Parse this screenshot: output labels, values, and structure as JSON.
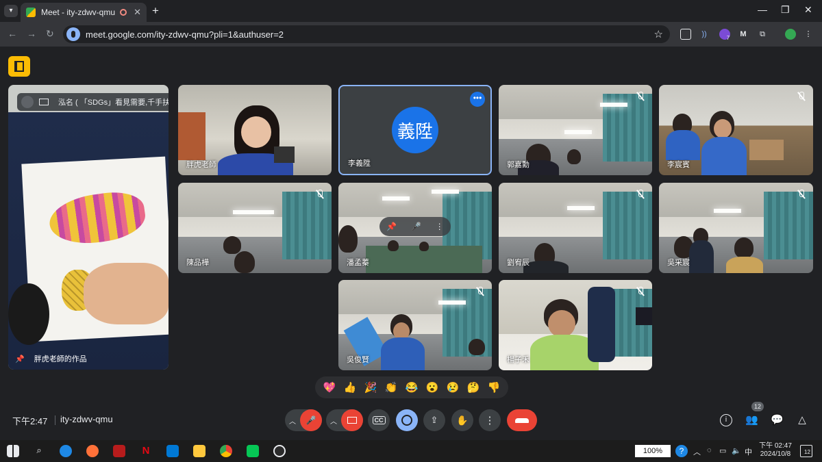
{
  "browser": {
    "tab_title": "Meet - ity-zdwv-qmu",
    "url": "meet.google.com/ity-zdwv-qmu?pli=1&authuser=2",
    "extension_badge": "7",
    "extension_letter": "M"
  },
  "meet": {
    "presentation": {
      "title": "泓名 ( 「SDGs」看見需要,千手扶學 專任助...",
      "name": "胖虎老師的作品"
    },
    "tiles": [
      {
        "name": "胖虎老師"
      },
      {
        "name": "李義陞",
        "initials": "義陞",
        "avatar_color": "#1a73e8"
      },
      {
        "name": "郭嘉勳"
      },
      {
        "name": "李宸賓"
      },
      {
        "name": "陳品樺"
      },
      {
        "name": "潘孟蓁"
      },
      {
        "name": "劉宥辰"
      },
      {
        "name": "吳采宸"
      },
      {
        "name": "吳俊賢"
      },
      {
        "name": "楊子禾"
      }
    ],
    "reactions": [
      "💖",
      "👍",
      "🎉",
      "👏",
      "😂",
      "😮",
      "😢",
      "🤔",
      "👎"
    ],
    "bottom": {
      "clock": "下午2:47",
      "meeting_code": "ity-zdwv-qmu",
      "people_count": "12",
      "cc_label": "CC"
    }
  },
  "taskbar": {
    "zoom": "100%",
    "ime": "中",
    "time": "下午 02:47",
    "date": "2024/10/8",
    "notifications": "12"
  }
}
